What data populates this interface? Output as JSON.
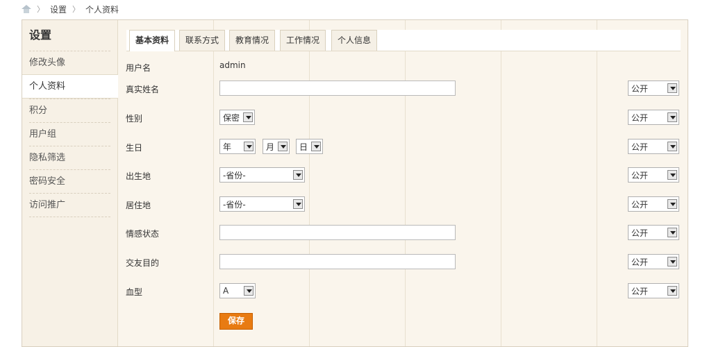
{
  "breadcrumb": {
    "home_icon": "home-icon",
    "items": [
      "设置",
      "个人资料"
    ]
  },
  "sidebar": {
    "title": "设置",
    "items": [
      {
        "label": "修改头像"
      },
      {
        "label": "个人资料"
      },
      {
        "label": "积分"
      },
      {
        "label": "用户组"
      },
      {
        "label": "隐私筛选"
      },
      {
        "label": "密码安全"
      },
      {
        "label": "访问推广"
      }
    ],
    "active_index": 1
  },
  "tabs": [
    {
      "label": "基本资料",
      "active": true
    },
    {
      "label": "联系方式"
    },
    {
      "label": "教育情况"
    },
    {
      "label": "工作情况"
    },
    {
      "label": "个人信息"
    }
  ],
  "form": {
    "username_label": "用户名",
    "username_value": "admin",
    "realname_label": "真实姓名",
    "realname_value": "",
    "gender_label": "性别",
    "gender_value": "保密",
    "birthday_label": "生日",
    "birthday_year": "年",
    "birthday_month": "月",
    "birthday_day": "日",
    "birthplace_label": "出生地",
    "birthplace_value": "-省份-",
    "residence_label": "居住地",
    "residence_value": "-省份-",
    "relationship_label": "情感状态",
    "relationship_value": "",
    "purpose_label": "交友目的",
    "purpose_value": "",
    "blood_label": "血型",
    "blood_value": "A",
    "privacy_value": "公开",
    "save_label": "保存"
  },
  "colors": {
    "accent": "#e87b12",
    "panel_bg": "#faf5ec",
    "border": "#d8cfbf"
  }
}
